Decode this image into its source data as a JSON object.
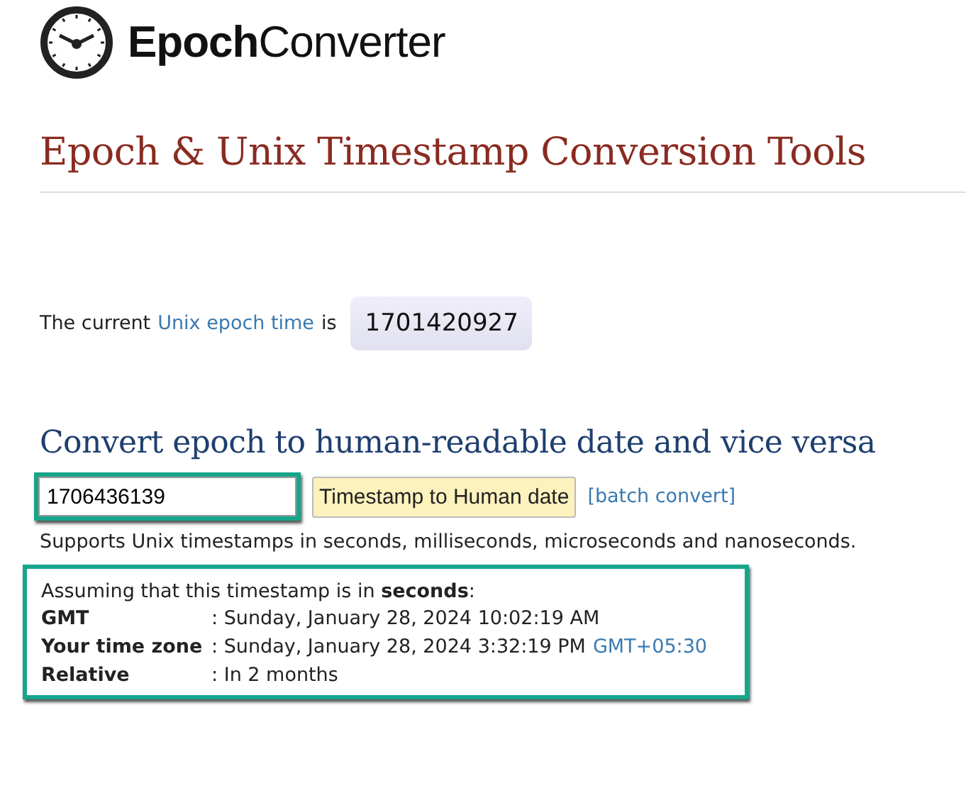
{
  "logo": {
    "text": "**Epoch**Converter"
  },
  "title": "Epoch & Unix Timestamp Conversion Tools",
  "current": {
    "prefix": "The current",
    "link": "Unix epoch time",
    "suffix": "is",
    "value": "1701420927"
  },
  "converter": {
    "heading": "Convert epoch to human-readable date and vice versa",
    "input": {
      "value": "1706436139",
      "highlighted": true
    },
    "button": "Timestamp to Human date",
    "link": "[batch convert]",
    "note": "Supports Unix timestamps in seconds, milliseconds, microseconds and nanoseconds."
  },
  "result": {
    "highlighted": true,
    "intro": "Assuming that this timestamp is in **seconds**:",
    "rows": [
      {
        "label": "GMT",
        "value": ": Sunday, January 28, 2024 10:02:19 AM"
      },
      {
        "label": "Your time zone",
        "value": ": Sunday, January 28, 2024 3:32:19 PM",
        "link": "GMT+05:30"
      },
      {
        "label": "Relative",
        "value": ": In 2 months"
      }
    ]
  }
}
